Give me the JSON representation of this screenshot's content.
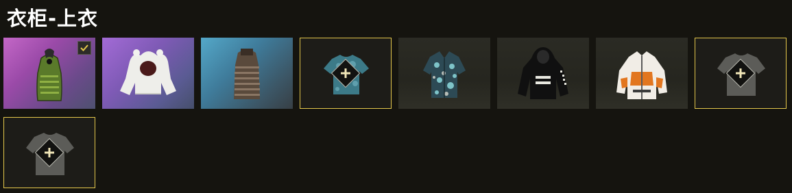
{
  "title": "衣柜-上衣",
  "accent_color": "#e6c94c",
  "slots": [
    {
      "name": "slot-green-tank",
      "icon": "green-tank-top-icon",
      "equipped": true
    },
    {
      "name": "slot-white-bear-hoodie",
      "icon": "white-bear-hoodie-icon",
      "equipped": false
    },
    {
      "name": "slot-striped-vest",
      "icon": "striped-vest-icon",
      "equipped": false
    },
    {
      "name": "slot-empty-tshirt",
      "icon": "teal-tshirt-icon",
      "equipped": false,
      "empty": true
    },
    {
      "name": "slot-floral-shirt",
      "icon": "floral-shirt-icon",
      "equipped": false
    },
    {
      "name": "slot-black-hoodie",
      "icon": "black-hoodie-icon",
      "equipped": false
    },
    {
      "name": "slot-orange-jacket",
      "icon": "orange-jacket-icon",
      "equipped": false
    },
    {
      "name": "slot-empty-gray-1",
      "icon": "gray-tshirt-icon",
      "equipped": false,
      "empty": true
    },
    {
      "name": "slot-empty-gray-2",
      "icon": "gray-tshirt-icon",
      "equipped": false,
      "empty": true
    }
  ]
}
